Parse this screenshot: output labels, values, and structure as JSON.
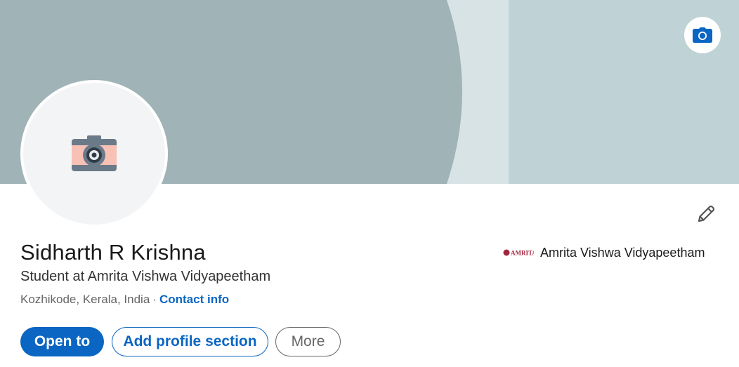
{
  "profile": {
    "name": "Sidharth R Krishna",
    "headline": "Student at Amrita Vishwa Vidyapeetham",
    "location": "Kozhikode, Kerala, India",
    "separator": "·",
    "contact_label": "Contact info"
  },
  "education": {
    "logo_text": "AMRITA",
    "school_name": "Amrita Vishwa Vidyapeetham"
  },
  "actions": {
    "open_to": "Open to",
    "add_section": "Add profile section",
    "more": "More"
  },
  "icons": {
    "banner_edit": "camera-icon",
    "avatar": "camera-illustration-icon",
    "edit": "pencil-icon"
  },
  "colors": {
    "brand_blue": "#0a66c2",
    "banner_dark": "#a0b3b6",
    "banner_mid": "#d7e3e5",
    "banner_light": "#bfd3d6"
  }
}
